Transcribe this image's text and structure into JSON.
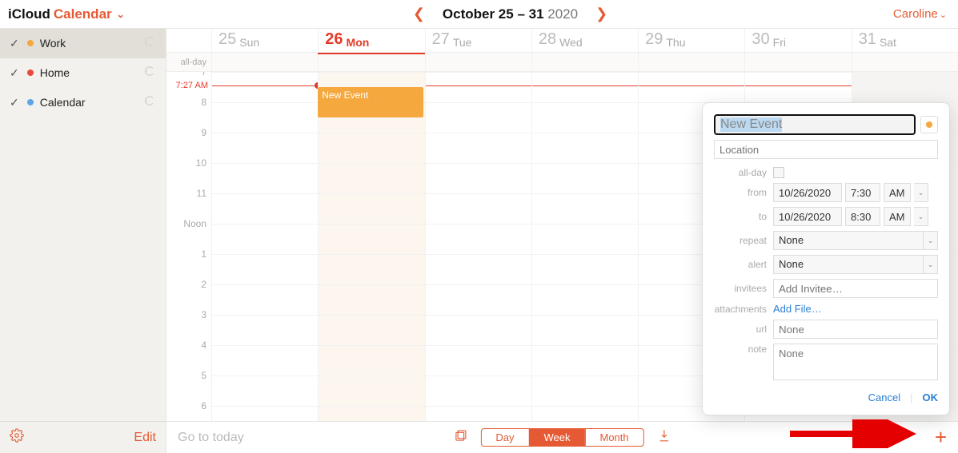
{
  "header": {
    "app_prefix": "iCloud",
    "app_name": "Calendar",
    "date_range_strong": "October 25 – 31",
    "date_range_year": "2020",
    "user": "Caroline"
  },
  "sidebar": {
    "items": [
      {
        "name": "Work",
        "color": "#f4a83e",
        "selected": true
      },
      {
        "name": "Home",
        "color": "#e84b3a",
        "selected": false
      },
      {
        "name": "Calendar",
        "color": "#5aa6e6",
        "selected": false
      }
    ],
    "edit_label": "Edit"
  },
  "days": [
    {
      "num": "25",
      "dow": "Sun",
      "today": false
    },
    {
      "num": "26",
      "dow": "Mon",
      "today": true
    },
    {
      "num": "27",
      "dow": "Tue",
      "today": false
    },
    {
      "num": "28",
      "dow": "Wed",
      "today": false
    },
    {
      "num": "29",
      "dow": "Thu",
      "today": false
    },
    {
      "num": "30",
      "dow": "Fri",
      "today": false
    },
    {
      "num": "31",
      "dow": "Sat",
      "today": false
    }
  ],
  "allday_label": "all-day",
  "hours": [
    "7",
    "8",
    "9",
    "10",
    "11",
    "Noon",
    "1",
    "2",
    "3",
    "4",
    "5",
    "6"
  ],
  "now_label": "7:27 AM",
  "event": {
    "title": "New Event",
    "color": "#f4a83e"
  },
  "bottombar": {
    "goto": "Go to today",
    "views": [
      {
        "label": "Day",
        "active": false
      },
      {
        "label": "Week",
        "active": true
      },
      {
        "label": "Month",
        "active": false
      }
    ]
  },
  "popover": {
    "title": "New Event",
    "location_placeholder": "Location",
    "allday_label": "all-day",
    "from_label": "from",
    "from_date": "10/26/2020",
    "from_time": "7:30",
    "from_ampm": "AM",
    "to_label": "to",
    "to_date": "10/26/2020",
    "to_time": "8:30",
    "to_ampm": "AM",
    "repeat_label": "repeat",
    "repeat_value": "None",
    "alert_label": "alert",
    "alert_value": "None",
    "invitees_label": "invitees",
    "invitees_placeholder": "Add Invitee…",
    "attachments_label": "attachments",
    "attachments_action": "Add File…",
    "url_label": "url",
    "url_placeholder": "None",
    "note_label": "note",
    "note_placeholder": "None",
    "cancel": "Cancel",
    "ok": "OK",
    "dot_color": "#f4a83e"
  }
}
